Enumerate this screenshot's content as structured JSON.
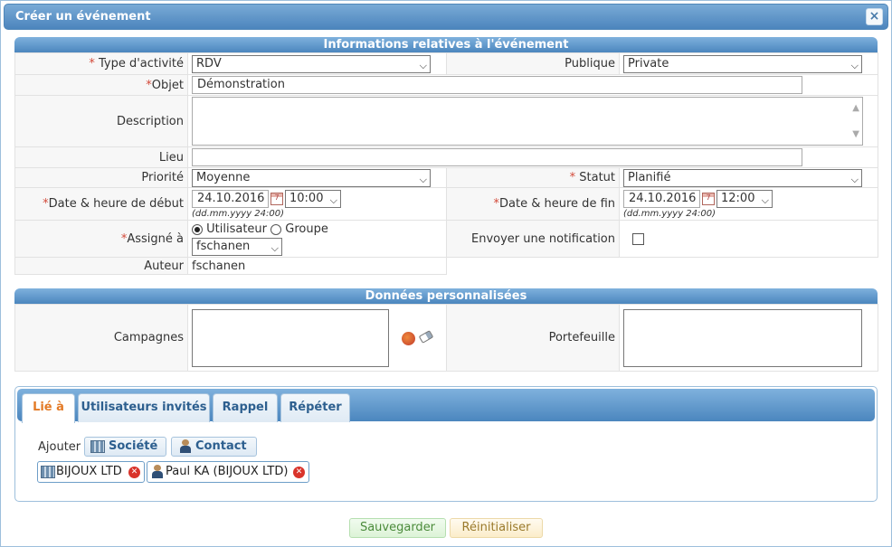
{
  "dialog": {
    "title": "Créer un événement",
    "close_glyph": "×"
  },
  "event_info": {
    "header": "Informations relatives à l'événement",
    "type_label": "Type d'activité",
    "type_value": "RDV",
    "public_label": "Publique",
    "public_value": "Private",
    "subject_label": "Objet",
    "subject_value": "Démonstration",
    "description_label": "Description",
    "description_value": "",
    "location_label": "Lieu",
    "location_value": "",
    "priority_label": "Priorité",
    "priority_value": "Moyenne",
    "status_label": "Statut",
    "status_value": "Planifié",
    "start_label": "Date & heure de début",
    "start_date": "24.10.2016",
    "start_time": "10:00",
    "end_label": "Date & heure de fin",
    "end_date": "24.10.2016",
    "end_time": "12:00",
    "date_hint": "(dd.mm.yyyy 24:00)",
    "assigned_label": "Assigné à",
    "assign_user_option": "Utilisateur",
    "assign_group_option": "Groupe",
    "assigned_value": "fschanen",
    "notify_label": "Envoyer une notification",
    "author_label": "Auteur",
    "author_value": "fschanen",
    "required_mark": "*"
  },
  "custom_data": {
    "header": "Données personnalisées",
    "campaigns_label": "Campagnes",
    "portfolio_label": "Portefeuille"
  },
  "tabs": {
    "items": [
      {
        "label": "Lié à"
      },
      {
        "label": "Utilisateurs invités"
      },
      {
        "label": "Rappel"
      },
      {
        "label": "Répéter"
      }
    ],
    "add_label": "Ajouter",
    "add_company": "Société",
    "add_contact": "Contact",
    "linked": [
      {
        "label": "BIJOUX LTD",
        "icon": "building-icon"
      },
      {
        "label": "Paul KA (BIJOUX LTD)",
        "icon": "person-icon"
      }
    ]
  },
  "footer": {
    "save": "Sauvegarder",
    "reset": "Réinitialiser"
  },
  "colors": {
    "header": "#4b86be",
    "required": "#d34a3a",
    "active_tab": "#e37a26"
  }
}
